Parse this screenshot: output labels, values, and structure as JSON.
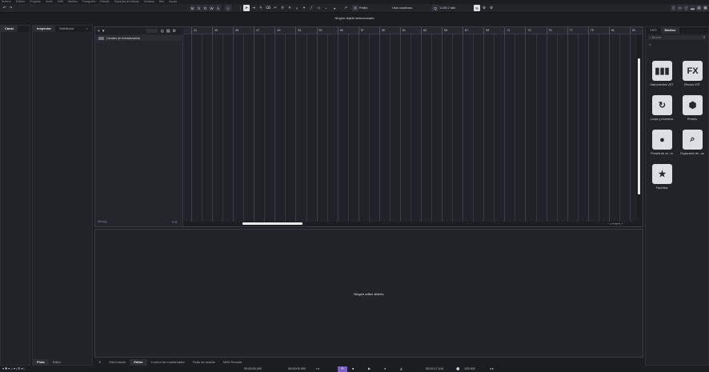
{
  "menu": [
    "Archivo",
    "Edición",
    "Proyecto",
    "Audio",
    "MIDI",
    "Medios",
    "Transporte",
    "Estudio",
    "Espacios de trabajo",
    "Ventana",
    "Hub",
    "Ayuda"
  ],
  "toolbar": {
    "modes": [
      "M",
      "S",
      "R",
      "W",
      "A"
    ],
    "snap_label": "Rejilla",
    "quantize_grid": "Usar cuantizac.",
    "quantize_value": "1/128 2 sillo",
    "colors": {
      "accent": "#9b73e6",
      "active": "#dcdfe3"
    }
  },
  "status": {
    "info_line": "Ningún objeto seleccionado"
  },
  "left": {
    "tabs_a": [
      "Canal"
    ],
    "tabs_b": [
      "Inspector",
      "Visibilidad"
    ],
    "bottom_tabs": [
      "Pista",
      "Editor"
    ]
  },
  "project": {
    "tracklist_filter": "",
    "folder_track": "Canales de entrada/salida",
    "bottom_label": "Mixing",
    "ruler_bars": [
      "41",
      "43",
      "45",
      "47",
      "49",
      "51",
      "53",
      "55",
      "57",
      "59",
      "61",
      "63",
      "65",
      "67",
      "69",
      "71",
      "73",
      "75",
      "77",
      "79",
      "81",
      "83"
    ]
  },
  "lower": {
    "placeholder": "Ningún editor abierto",
    "tabs": [
      "MixConsole",
      "Editor",
      "Control de muestreador",
      "Pads de acorde",
      "MIDI Remote"
    ],
    "selected_tab": "Editor"
  },
  "right": {
    "tabs": [
      "VSTi",
      "Medios"
    ],
    "search_placeholder": "Buscar",
    "media_items": [
      {
        "label": "Instrumentos VST",
        "icon": "piano-icon",
        "glyph": "▮▮▮"
      },
      {
        "label": "Efectos VST",
        "icon": "fx-icon",
        "glyph": "FX"
      },
      {
        "label": "Loops y muestras",
        "icon": "loop-icon",
        "glyph": "↻"
      },
      {
        "label": "Presets",
        "icon": "presets-icon",
        "glyph": "⬢"
      },
      {
        "label": "Presets de us...io",
        "icon": "user-presets-icon",
        "glyph": "●"
      },
      {
        "label": "Explorador de...os",
        "icon": "browser-icon",
        "glyph": "⌕"
      },
      {
        "label": "Favoritos",
        "icon": "star-icon",
        "glyph": "★"
      }
    ]
  },
  "transport": {
    "left_locator": "00:00:00.000",
    "right_locator": "00:00:00.000",
    "position": "00:02:17.014",
    "tempo": "120.000"
  }
}
